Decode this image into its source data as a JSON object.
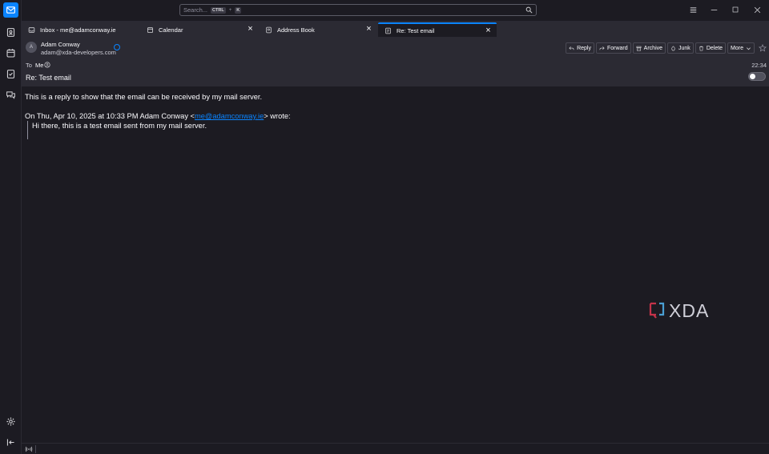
{
  "search": {
    "placeholder": "Search...",
    "shortcut_ctrl": "CTRL",
    "shortcut_plus": "+",
    "shortcut_key": "K"
  },
  "tabs": [
    {
      "label": "Inbox - me@adamconway.ie",
      "icon": "inbox-icon"
    },
    {
      "label": "Calendar",
      "icon": "calendar-icon"
    },
    {
      "label": "Address Book",
      "icon": "address-book-icon"
    },
    {
      "label": "Re: Test email",
      "icon": "message-icon",
      "active": true
    }
  ],
  "header": {
    "avatar_initial": "A",
    "from_name": "Adam Conway",
    "from_email": "adam@xda-developers.com",
    "to_label": "To",
    "to_value": "Me",
    "time": "22:34",
    "subject": "Re: Test email"
  },
  "actions": {
    "reply": "Reply",
    "forward": "Forward",
    "archive": "Archive",
    "junk": "Junk",
    "delete": "Delete",
    "more": "More"
  },
  "body": {
    "reply_text": "This is a reply to show that the email can be received by my mail server.",
    "attribution_prefix": "On Thu, Apr 10, 2025 at 10:33 PM Adam Conway <",
    "attribution_link": "me@adamconway.ie",
    "attribution_suffix": "> wrote:",
    "quoted_text": "Hi there, this is a test email sent from my mail server."
  },
  "watermark": "XDA",
  "colors": {
    "accent": "#0a84ff",
    "background": "#1c1b22",
    "header_bg": "#2b2a33"
  }
}
